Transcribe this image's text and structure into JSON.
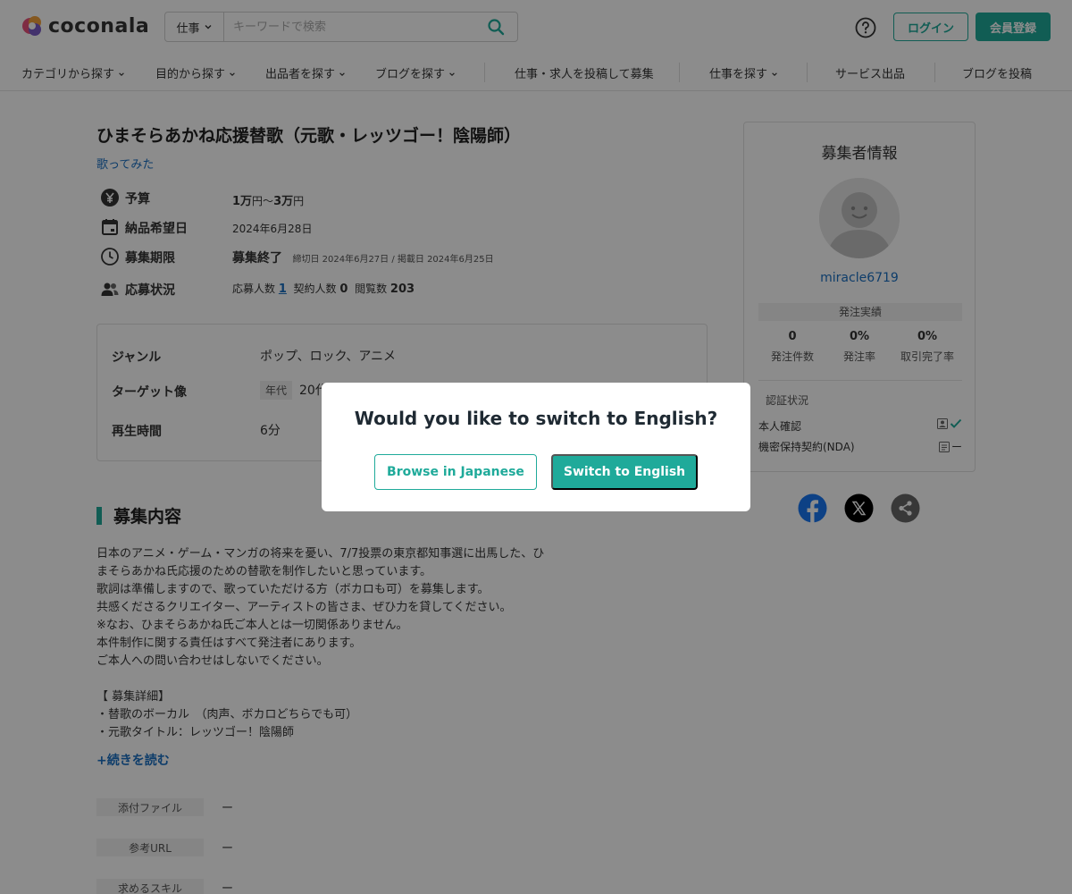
{
  "header": {
    "logo_text": "coconala",
    "search_category": "仕事",
    "search_placeholder": "キーワードで検索",
    "login_label": "ログイン",
    "signup_label": "会員登録"
  },
  "nav": {
    "items": [
      "カテゴリから探す",
      "目的から探す",
      "出品者を探す",
      "ブログを探す",
      "仕事・求人を投稿して募集",
      "仕事を探す",
      "サービス出品",
      "ブログを投稿"
    ]
  },
  "job": {
    "title": "ひまそらあかね応援替歌（元歌・レッツゴー！陰陽師）",
    "category": "歌ってみた",
    "budget_label": "予算",
    "budget_min": "1万",
    "budget_yen1": "円～",
    "budget_max": "3万",
    "budget_yen2": "円",
    "deadline_label": "納品希望日",
    "deadline_value": "2024年6月28日",
    "period_label": "募集期限",
    "period_status": "募集終了",
    "period_dates": "締切日 2024年6月27日 / 掲載日 2024年6月25日",
    "status_label": "応募状況",
    "applicants_label": "応募人数",
    "applicants_value": "1",
    "contracts_label": "契約人数",
    "contracts_value": "0",
    "views_label": "閲覧数",
    "views_value": "203"
  },
  "details": {
    "genre_label": "ジャンル",
    "genre_value": "ポップ、ロック、アニメ",
    "target_label": "ターゲット像",
    "target_tag": "年代",
    "target_value": "20代",
    "duration_label": "再生時間",
    "duration_value": "6分"
  },
  "content": {
    "section_title": "募集内容",
    "lines": [
      "日本のアニメ・ゲーム・マンガの将来を憂い、7/7投票の東京都知事選に出馬した、ひ",
      "まそらあかね氏応援のための替歌を制作したいと思っています。",
      "歌詞は準備しますので、歌っていただける方（ボカロも可）を募集します。",
      "共感くださるクリエイター、アーティストの皆さま、ぜひ力を貸してください。",
      "※なお、ひまそらあかね氏ご本人とは一切関係ありません。",
      "本件制作に関する責任はすべて発注者にあります。",
      "ご本人への問い合わせはしないでください。",
      "",
      "【 募集詳細】",
      "・替歌のボーカル　（肉声、ボカロどちらでも可）",
      "・元歌タイトル：レッツゴー！陰陽師"
    ],
    "read_more": "+続きを読む"
  },
  "meta": {
    "attachments_label": "添付ファイル",
    "attachments_value": "ー",
    "url_label": "参考URL",
    "url_value": "ー",
    "skills_label": "求めるスキル",
    "skills_value": "ー"
  },
  "sidebar": {
    "title": "募集者情報",
    "username": "miracle6719",
    "stats_title": "発注実績",
    "orders_value": "0",
    "orders_label": "発注件数",
    "order_rate_value": "0%",
    "order_rate_label": "発注率",
    "completion_value": "0%",
    "completion_label": "取引完了率",
    "verify_title": "認証状況",
    "identity_label": "本人確認",
    "nda_label": "機密保持契約(NDA)",
    "nda_value": "ー"
  },
  "modal": {
    "title": "Would you like to switch to English?",
    "browse_jp": "Browse in Japanese",
    "switch_en": "Switch to English"
  },
  "colors": {
    "accent": "#1faa9a",
    "link": "#1b6fc2",
    "facebook": "#1877f2"
  }
}
